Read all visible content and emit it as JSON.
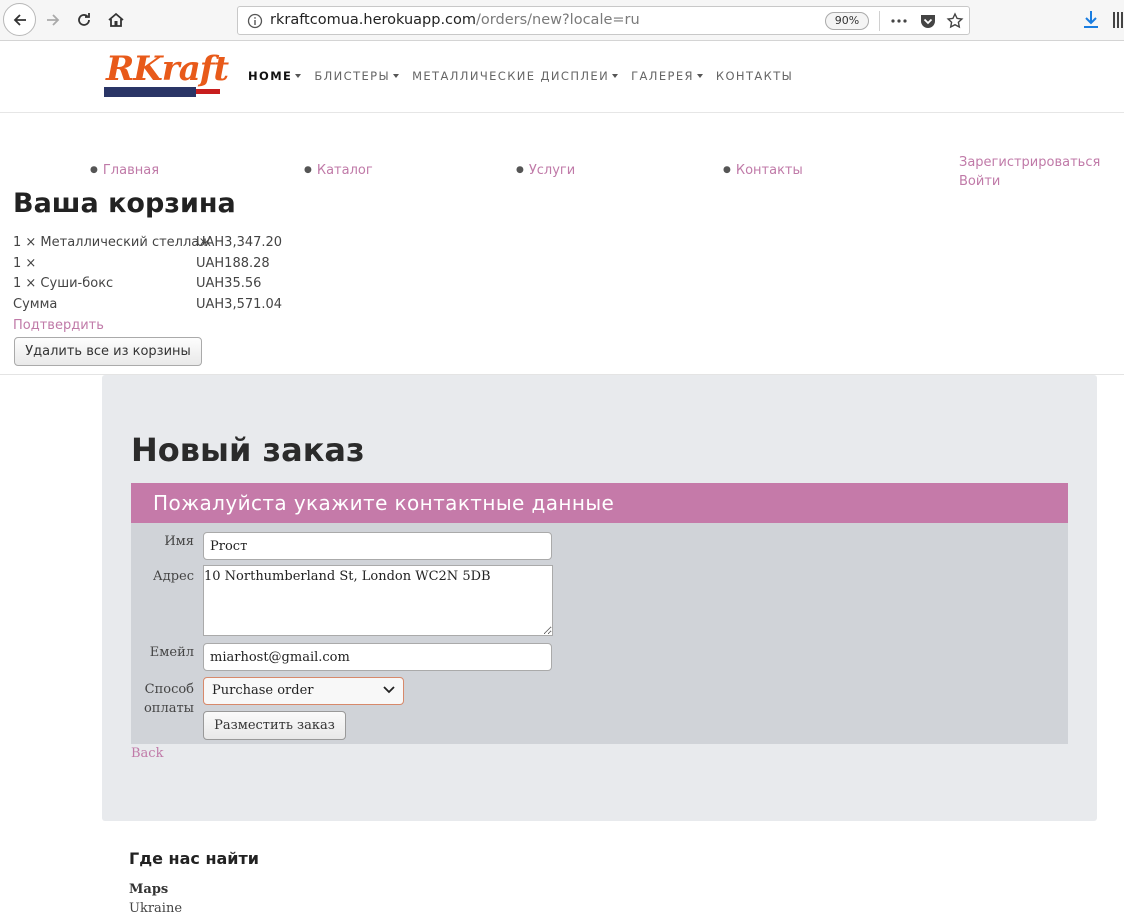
{
  "browser": {
    "url_host": "rkraftcomua.herokuapp.com",
    "url_path": "/orders/new?locale=ru",
    "zoom": "90%"
  },
  "logo": {
    "text": "RKraft"
  },
  "main_nav": [
    {
      "label": "HOME",
      "active": true,
      "caret": true
    },
    {
      "label": "БЛИСТЕРЫ",
      "caret": true
    },
    {
      "label": "МЕТАЛЛИЧЕСКИЕ ДИСПЛЕИ",
      "caret": true
    },
    {
      "label": "ГАЛЕРЕЯ",
      "caret": true
    },
    {
      "label": "КОНТАКТЫ",
      "caret": false
    }
  ],
  "sub_nav": [
    {
      "label": "Главная"
    },
    {
      "label": "Каталог"
    },
    {
      "label": "Услуги"
    },
    {
      "label": "Контакты"
    }
  ],
  "auth": {
    "register": "Зарегистрироваться",
    "login": "Войти"
  },
  "cart": {
    "title": "Ваша корзина",
    "items": [
      {
        "qty": "1 × Металлический стеллаж",
        "price": "UAH3,347.20"
      },
      {
        "qty": "1 ×",
        "price": "UAH188.28"
      },
      {
        "qty": "1 × Суши-бокс",
        "price": "UAH35.56"
      }
    ],
    "total_label": "Сумма",
    "total_value": "UAH3,571.04",
    "confirm": "Подтвердить",
    "clear_button": "Удалить все из корзины"
  },
  "order": {
    "title": "Новый заказ",
    "banner": "Пожалуйста укажите контактные данные",
    "name_label": "Имя",
    "name_value": "Proст",
    "address_label": "Адрес",
    "address_value": "10 Northumberland St, London WC2N 5DB",
    "email_label": "Емейл",
    "email_value": "miarhost@gmail.com",
    "payment_label_1": "Способ",
    "payment_label_2": "оплаты",
    "payment_value": "Purchase order",
    "submit": "Разместить заказ",
    "back": "Back"
  },
  "footer": {
    "title": "Где нас найти",
    "maps": "Maps",
    "country": "Ukraine"
  }
}
